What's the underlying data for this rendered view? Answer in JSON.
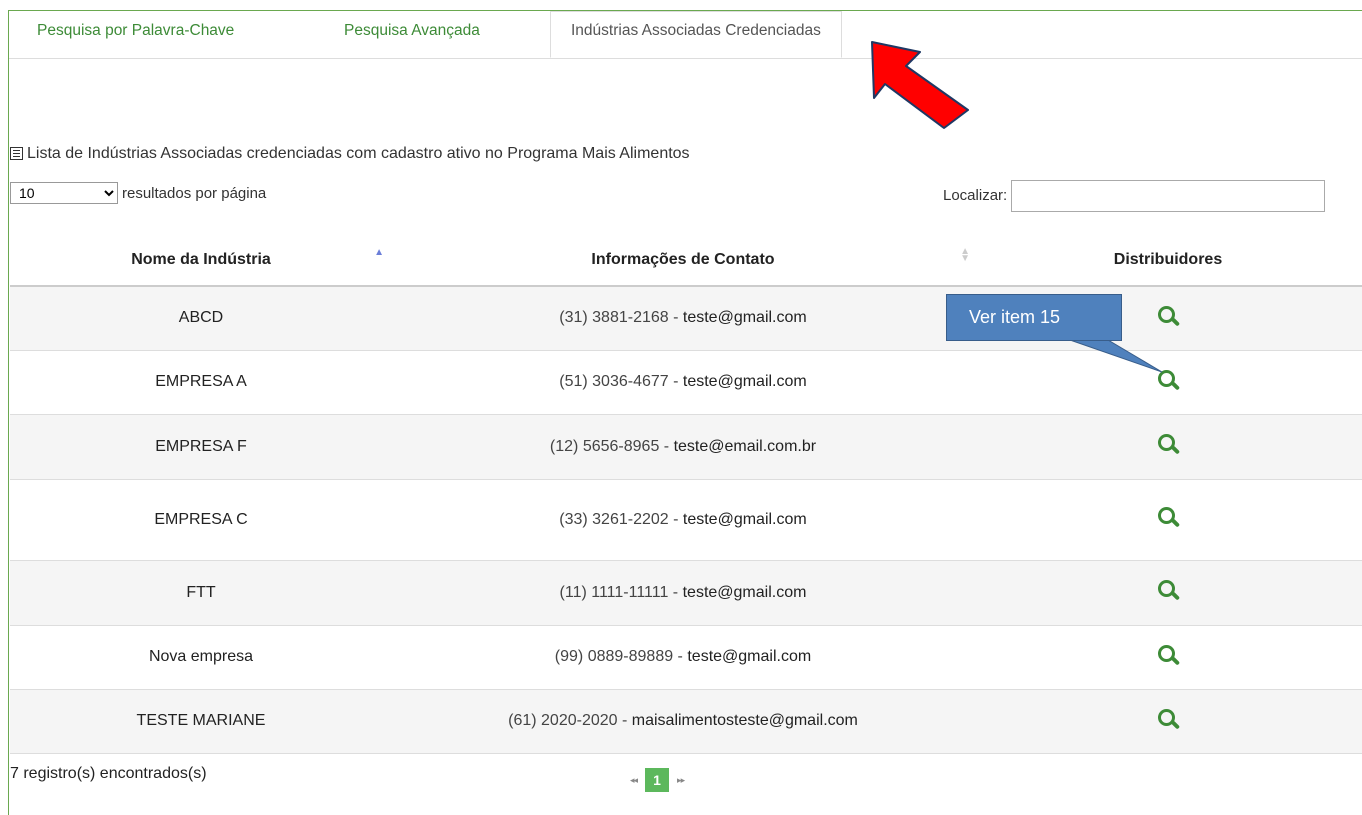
{
  "tabs": [
    {
      "label": "Pesquisa por Palavra-Chave"
    },
    {
      "label": "Pesquisa Avançada"
    },
    {
      "label": "Indústrias Associadas Credenciadas"
    }
  ],
  "caption": "Lista de Indústrias Associadas credenciadas com cadastro ativo no Programa Mais Alimentos",
  "length": {
    "selected": "10",
    "suffix": "resultados por página"
  },
  "search": {
    "label": "Localizar:",
    "value": ""
  },
  "table": {
    "headers": [
      "Nome da Indústria",
      "Informações de Contato",
      "Distribuidores"
    ],
    "rows": [
      {
        "name": "ABCD",
        "phone": "(31) 3881-2168 -",
        "email": "teste@gmail.com"
      },
      {
        "name": "EMPRESA A",
        "phone": "(51) 3036-4677 -",
        "email": "teste@gmail.com"
      },
      {
        "name": "EMPRESA F",
        "phone": "(12) 5656-8965 -",
        "email": "teste@email.com.br"
      },
      {
        "name": "EMPRESA C",
        "phone": "(33) 3261-2202 -",
        "email": "teste@gmail.com"
      },
      {
        "name": "FTT",
        "phone": "(11) 1111-11111 -",
        "email": "teste@gmail.com"
      },
      {
        "name": "Nova empresa",
        "phone": "(99) 0889-89889 -",
        "email": "teste@gmail.com"
      },
      {
        "name": "TESTE MARIANE",
        "phone": "(61) 2020-2020 -",
        "email": "maisalimentosteste@gmail.com"
      }
    ]
  },
  "footer": {
    "info": "7 registro(s) encontrados(s)",
    "page": "1",
    "prev": "◂◂",
    "next": "▸▸"
  },
  "callout": {
    "text": "Ver item 15"
  },
  "colors": {
    "accent": "#3d8b37",
    "pager": "#5cb85c",
    "arrow": "#ff0000",
    "callout": "#4f81bd"
  }
}
